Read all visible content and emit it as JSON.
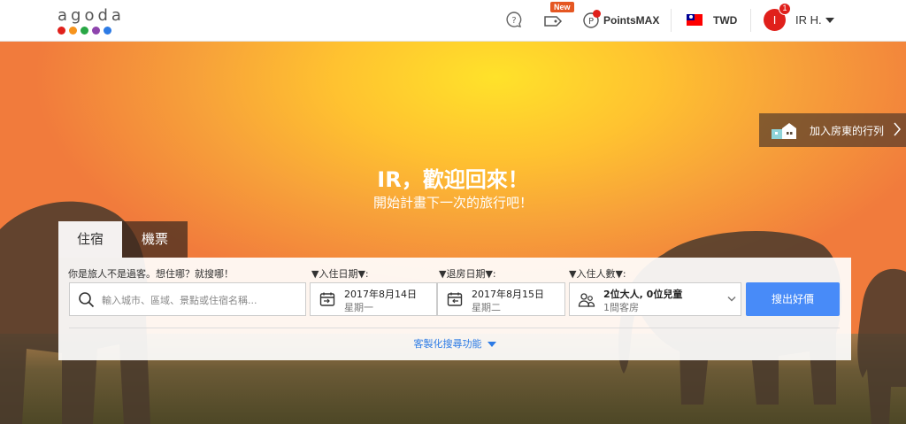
{
  "header": {
    "logo_text": "agoda",
    "logo_colors": [
      "#e0201b",
      "#f7941d",
      "#28a745",
      "#8e44ad",
      "#2d7be5"
    ],
    "new_badge": "New",
    "points_label": "PointsMAX",
    "currency": "TWD",
    "avatar_initial": "I",
    "notification_count": "1",
    "user_name": "IR H."
  },
  "hero": {
    "host_banner": "加入房東的行列",
    "welcome": "IR，歡迎回來！",
    "subwelcome": "開始計畫下一次的旅行吧！"
  },
  "tabs": [
    {
      "label": "住宿"
    },
    {
      "label": "機票"
    }
  ],
  "search": {
    "destination_label": "你是旅人不是過客。想住哪？就搜哪！",
    "destination_placeholder": "輸入城市、區域、景點或住宿名稱...",
    "checkin_label": "▼入住日期▼:",
    "checkin_date": "2017年8月14日",
    "checkin_day": "星期一",
    "checkout_label": "▼退房日期▼:",
    "checkout_date": "2017年8月15日",
    "checkout_day": "星期二",
    "guests_label": "▼入住人數▼:",
    "guests_main": "2位大人, 0位兒童",
    "guests_sub": "1間客房",
    "search_button": "搜出好價",
    "custom_link": "客製化搜尋功能"
  },
  "colors": {
    "accent": "#488bf8",
    "link": "#2d7be5",
    "brand_red": "#e0201b"
  }
}
